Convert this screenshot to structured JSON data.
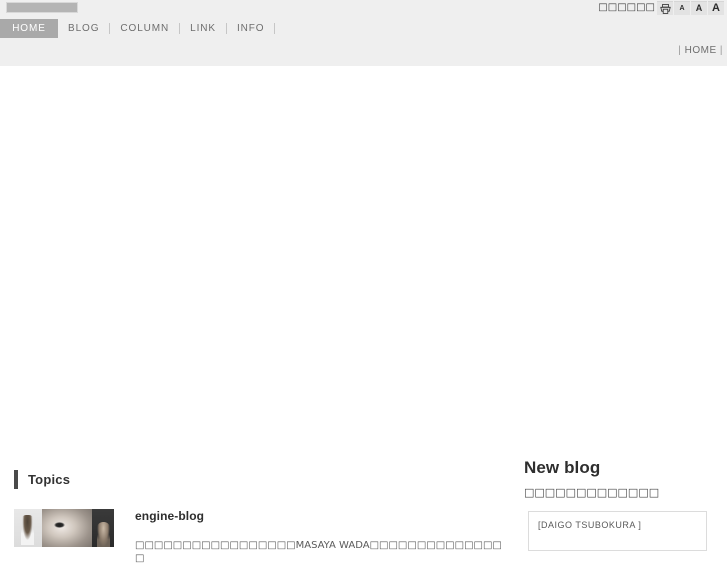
{
  "header": {
    "logo_alt": "site-logo",
    "utility": {
      "label": "□□□□□□",
      "buttons": [
        {
          "name": "print-button",
          "glyph": "printer-icon",
          "label": ""
        },
        {
          "name": "font-size-small-button",
          "glyph": "letter-a",
          "label": "A"
        },
        {
          "name": "font-size-medium-button",
          "glyph": "letter-a",
          "label": "A"
        },
        {
          "name": "font-size-large-button",
          "glyph": "letter-a",
          "label": "A"
        }
      ]
    },
    "nav": [
      {
        "label": "HOME",
        "active": true
      },
      {
        "label": "BLOG",
        "active": false
      },
      {
        "label": "COLUMN",
        "active": false
      },
      {
        "label": "LINK",
        "active": false
      },
      {
        "label": "INFO",
        "active": false
      }
    ],
    "breadcrumb": {
      "left_pipe": "|",
      "current": "HOME",
      "right_pipe": "|"
    }
  },
  "topics": {
    "section_title": "Topics",
    "entries": [
      {
        "title": "engine-blog",
        "description": "□□□□□□□□□□□□□□□□□MASAYA WADA□□□□□□□□□□□□□□□"
      }
    ]
  },
  "new_blog": {
    "title": "New blog",
    "subtitle": "□□□□□□□□□□□□□",
    "entries": [
      {
        "text": "[DAIGO TSUBOKURA     ]"
      }
    ]
  },
  "colors": {
    "header_bg": "#efefef",
    "active_nav_bg": "#a9a9a9",
    "section_bar": "#4a4a4a",
    "box_border": "#dcdcdc",
    "page_bg": "#ffffff"
  }
}
